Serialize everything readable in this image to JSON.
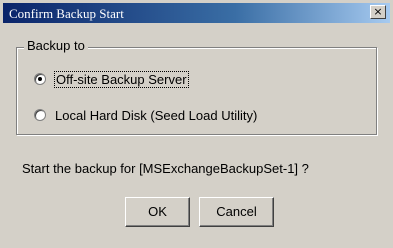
{
  "window": {
    "title": "Confirm Backup Start",
    "close_glyph": "×"
  },
  "group": {
    "legend": "Backup to",
    "options": [
      {
        "label": "Off-site Backup Server",
        "selected": true
      },
      {
        "label": "Local Hard Disk (Seed Load Utility)",
        "selected": false
      }
    ]
  },
  "message": "Start the backup for [MSExchangeBackupSet-1] ?",
  "buttons": {
    "ok": "OK",
    "cancel": "Cancel"
  }
}
